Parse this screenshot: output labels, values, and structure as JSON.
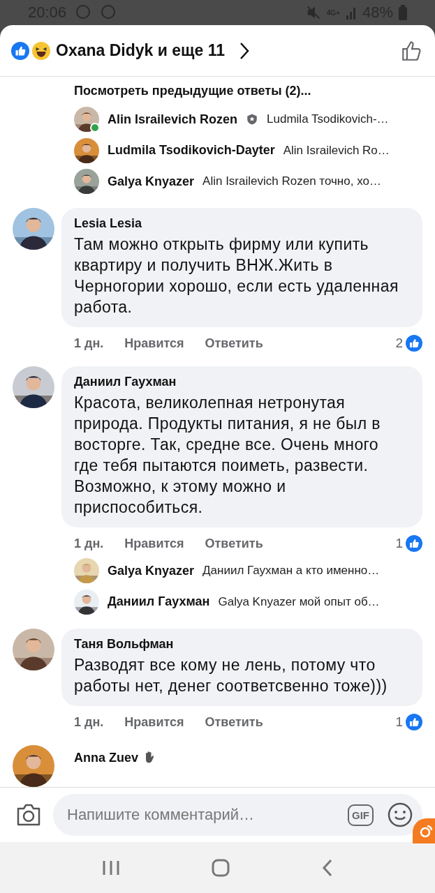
{
  "status_bar": {
    "time": "20:06",
    "network": "4G+",
    "battery": "48%"
  },
  "header": {
    "title": "Oxana Didyk и еще 11"
  },
  "thread": [
    {
      "kind": "more-link",
      "text": "Посмотреть предыдущие ответы (2)..."
    },
    {
      "kind": "reply",
      "name": "Alin Israilevich Rozen",
      "badge": true,
      "online": true,
      "text": "Ludmila Tsodikovich-…"
    },
    {
      "kind": "reply",
      "name": "Ludmila Tsodikovich-Dayter",
      "badge": false,
      "online": false,
      "text": "Alin Israilevich Ro…"
    },
    {
      "kind": "reply",
      "name": "Galya Knyazer",
      "badge": false,
      "online": false,
      "text": "Alin Israilevich Rozen точно, хо…"
    },
    {
      "kind": "comment",
      "name": "Lesia Lesia",
      "text": "Там можно открыть фирму или купить квартиру и получить ВНЖ.Жить в Черногории хорошо, если есть удаленная работа.",
      "time": "1 дн.",
      "like": "Нравится",
      "reply": "Ответить",
      "likes": "2"
    },
    {
      "kind": "comment",
      "name": "Даниил Гаухман",
      "text": "Красота, великолепная нетронутая природа. Продукты питания, я не был в восторге. Так, средне все. Очень много где тебя пытаются поиметь, развести. Возможно, к этому можно и приспособиться.",
      "time": "1 дн.",
      "like": "Нравится",
      "reply": "Ответить",
      "likes": "1"
    },
    {
      "kind": "reply",
      "name": "Galya Knyazer",
      "badge": false,
      "online": false,
      "text": "Даниил Гаухман а кто именно…"
    },
    {
      "kind": "reply",
      "name": "Даниил Гаухман",
      "badge": false,
      "online": false,
      "text": "Galya Knyazer  мой опыт об…"
    },
    {
      "kind": "comment",
      "name": "Таня Вольфман",
      "text": "Разводят все кому не лень, потому что работы нет, денег соответсвенно тоже)))",
      "time": "1 дн.",
      "like": "Нравится",
      "reply": "Ответить",
      "likes": "1"
    },
    {
      "kind": "partial",
      "name": "Anna Zuev"
    }
  ],
  "composer": {
    "placeholder": "Напишите комментарий…",
    "gif": "GIF"
  }
}
